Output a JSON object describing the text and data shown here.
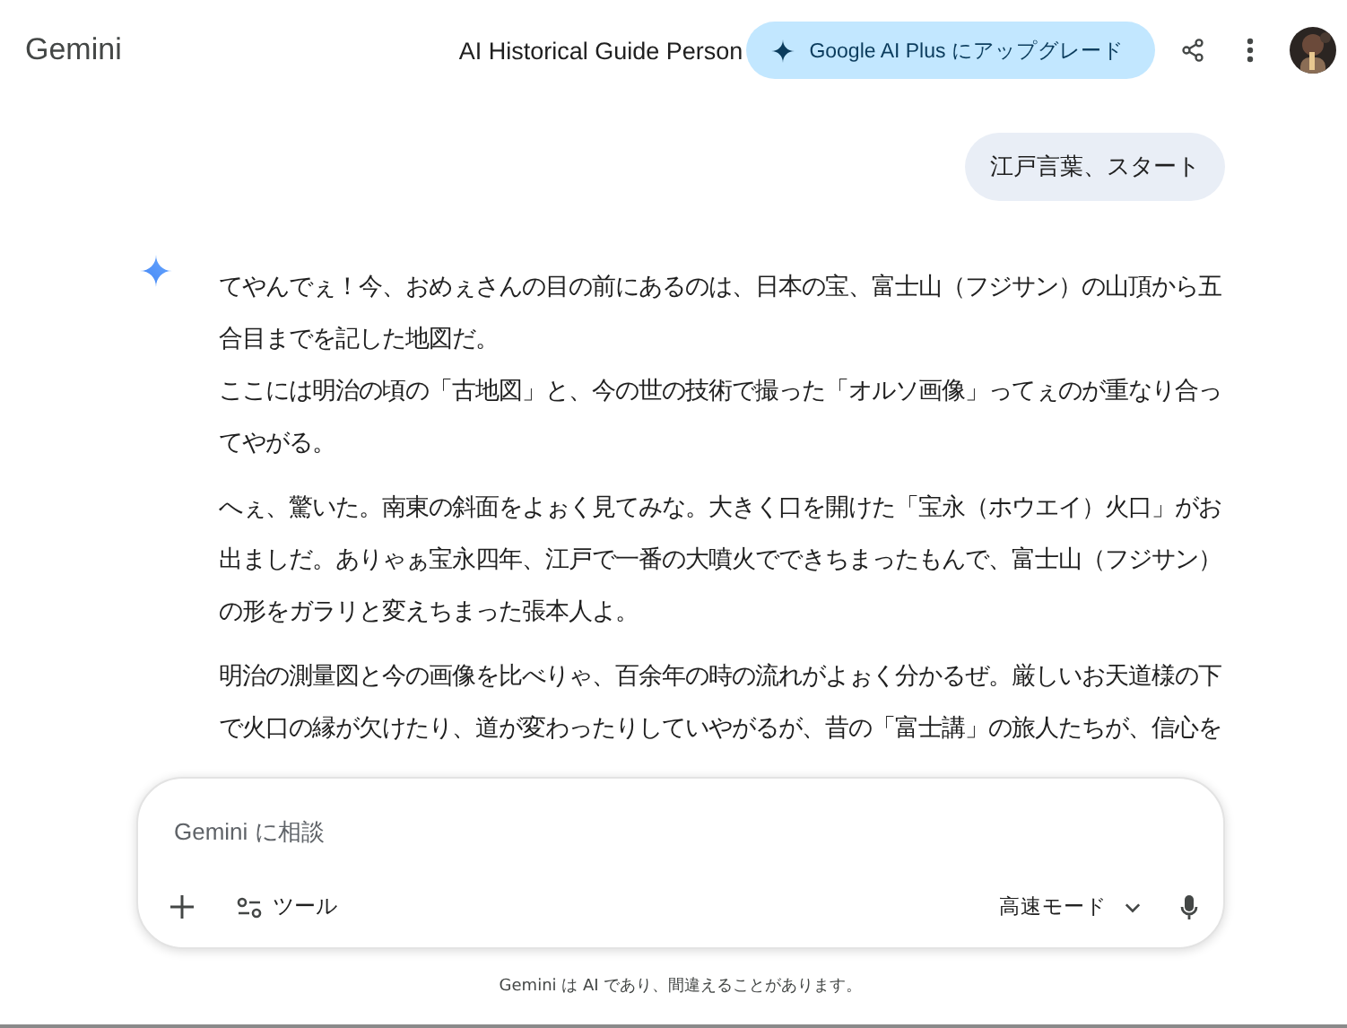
{
  "header": {
    "brand": "Gemini",
    "title": "AI Historical Guide Person",
    "upgrade_button": "Google AI Plus にアップグレード"
  },
  "user_message": "江戸言葉、スタート",
  "response": {
    "paragraphs": [
      {
        "lines": [
          "てやんでぇ！今、おめぇさんの目の前にあるのは、日本の宝、富士山（フジサン）の山頂から五",
          "合目までを記した地図だ。",
          "ここには明治の頃の「古地図」と、今の世の技術で撮った「オルソ画像」ってぇのが重なり合っ",
          "てやがる。"
        ]
      },
      {
        "lines": [
          "へぇ、驚いた。南東の斜面をよぉく見てみな。大きく口を開けた「宝永（ホウエイ）火口」がお",
          "出ましだ。ありゃぁ宝永四年、江戸で一番の大噴火でできちまったもんで、富士山（フジサン）",
          "の形をガラリと変えちまった張本人よ。"
        ]
      },
      {
        "lines": [
          "明治の測量図と今の画像を比べりゃ、百余年の時の流れがよぉく分かるぜ。厳しいお天道様の下",
          "で火口の縁が欠けたり、道が変わったりしていやがるが、昔の「富士講」の旅人たちが、信心を"
        ]
      }
    ]
  },
  "composer": {
    "placeholder": "Gemini に相談",
    "tools_button": "ツール",
    "mode_button": "高速モード"
  },
  "disclaimer": "Gemini は AI であり、間違えることがあります。"
}
